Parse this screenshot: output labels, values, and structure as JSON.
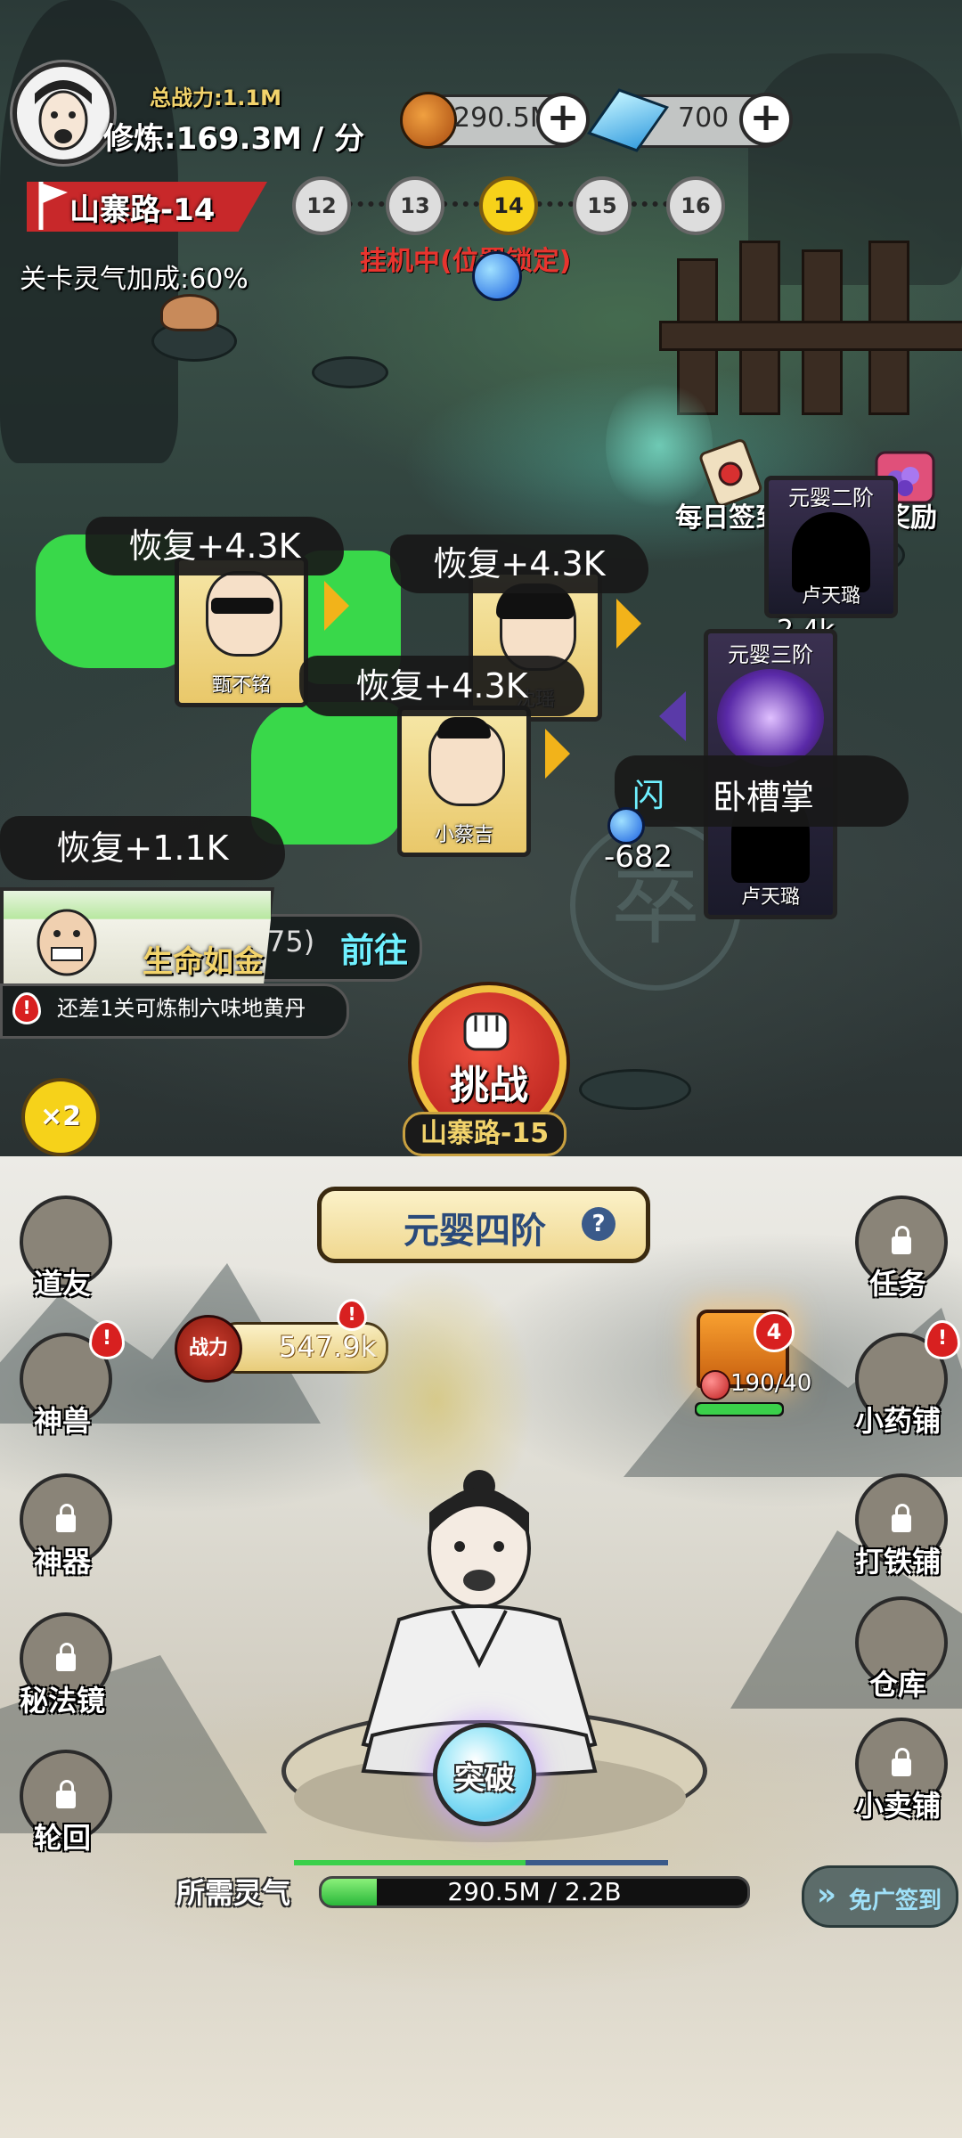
{
  "player": {
    "total_power": "总战力:1.1M",
    "cultivation_rate": "修炼:169.3M / 分"
  },
  "resources": {
    "spirit": "290.5M",
    "gems": "700"
  },
  "stage": {
    "name": "山寨路-14",
    "levels": [
      "12",
      "13",
      "14",
      "15",
      "16"
    ],
    "current_index": 2,
    "bonus": "关卡灵气加成:60%",
    "status": "挂机中(位置锁定)"
  },
  "top_right": {
    "daily_signin": "每日签到",
    "online_reward": "在线奖励"
  },
  "allies": [
    {
      "name": "甄不铭",
      "heal": "恢复+4.3K"
    },
    {
      "name": "沈瑶",
      "heal": "恢复+4.3K"
    },
    {
      "name": "小蔡吉",
      "heal": "恢复+4.3K"
    },
    {
      "name": "",
      "heal": "恢复+1.1K"
    }
  ],
  "enemies": [
    {
      "rank": "元婴二阶",
      "name": "卢天璐"
    },
    {
      "rank": "元婴三阶",
      "name": "卢天璐"
    }
  ],
  "combat": {
    "dodge": "闪",
    "skill": "卧槽掌",
    "damage": "-682",
    "enemy_dmg": "2.4k",
    "banner_watermark": "卒"
  },
  "quest": {
    "title": "生命如金",
    "progress": "75)",
    "goto": "前往",
    "hint": "还差1关可炼制六味地黄丹"
  },
  "speed": "×2",
  "challenge": {
    "label": "挑战",
    "next_stage": "山寨路-15"
  },
  "realm": {
    "title": "元婴四阶",
    "help": "?"
  },
  "power": {
    "label": "战力",
    "value": "547.9k"
  },
  "chest": {
    "badge": "4",
    "progress": "190/40"
  },
  "left_menu": [
    {
      "label": "道友",
      "icon": "daoyou-icon",
      "badge": false,
      "locked": false
    },
    {
      "label": "神兽",
      "icon": "beast-icon",
      "badge": true,
      "locked": false
    },
    {
      "label": "神器",
      "icon": "artifact-icon",
      "badge": false,
      "locked": true
    },
    {
      "label": "秘法镜",
      "icon": "mirror-icon",
      "badge": false,
      "locked": true
    },
    {
      "label": "轮回",
      "icon": "reincarnation-icon",
      "badge": false,
      "locked": true
    }
  ],
  "right_menu": [
    {
      "label": "任务",
      "icon": "task-icon",
      "badge": false,
      "locked": true
    },
    {
      "label": "小药铺",
      "icon": "pharmacy-icon",
      "badge": true,
      "locked": false
    },
    {
      "label": "打铁铺",
      "icon": "smithy-icon",
      "badge": false,
      "locked": true
    },
    {
      "label": "仓库",
      "icon": "warehouse-icon",
      "badge": false,
      "locked": false
    },
    {
      "label": "小卖铺",
      "icon": "shop-icon",
      "badge": false,
      "locked": true
    }
  ],
  "breakthrough": {
    "label": "突破",
    "required_label": "所需灵气",
    "required_value": "290.5M / 2.2B",
    "fill_fraction": 0.13
  },
  "ad_signin": "免广签到",
  "colors": {
    "gold_text": "#f2d36b",
    "red_badge": "#d82020",
    "heal_green": "#39d84a",
    "current_stage": "#f7d21a",
    "challenge_red": "#d8322a",
    "cyan_text": "#6ff0ff"
  }
}
